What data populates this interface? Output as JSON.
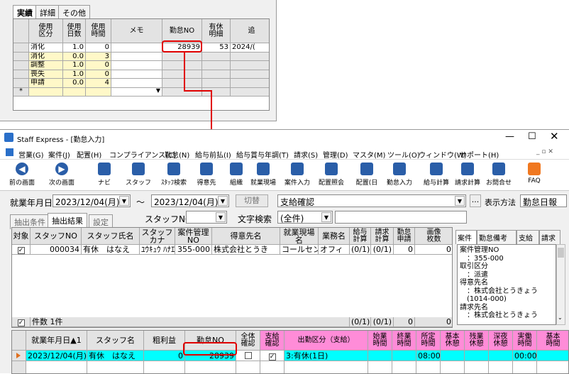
{
  "top": {
    "tabs": [
      "実績",
      "詳細",
      "その他"
    ],
    "headers": [
      "使用\n区分",
      "使用\n日数",
      "使用\n時間",
      "メモ",
      "勤怠NO",
      "有休\n明細",
      "追"
    ],
    "rows": [
      {
        "kubun": "消化",
        "days": "1.0",
        "hours": "0",
        "kintai": "28939",
        "yukyu": "53",
        "extra": "2024/("
      },
      {
        "kubun": "消化",
        "days": "0.0",
        "hours": "3",
        "kintai": "",
        "yukyu": "",
        "extra": ""
      },
      {
        "kubun": "調整",
        "days": "1.0",
        "hours": "0",
        "kintai": "",
        "yukyu": "",
        "extra": ""
      },
      {
        "kubun": "喪失",
        "days": "1.0",
        "hours": "0",
        "kintai": "",
        "yukyu": "",
        "extra": ""
      },
      {
        "kubun": "申請",
        "days": "0.0",
        "hours": "4",
        "kintai": "",
        "yukyu": "",
        "extra": ""
      }
    ],
    "new_row_marker": "*"
  },
  "window": {
    "title": "Staff Express - [勤怠入力]",
    "menu": [
      "営業(G)",
      "案件(J)",
      "配置(H)",
      "コンプライアンス(C)",
      "勤怠(N)",
      "給与前払(I)",
      "給与賞与年調(T)",
      "請求(S)",
      "管理(D)",
      "マスタ(M)",
      "ツール(O)",
      "ウィンドウ(W)",
      "サポート(H)"
    ],
    "toolbar": [
      "前の画面",
      "次の画面",
      "ナビ",
      "スタッフ",
      "ｽﾀｯﾌ検索",
      "得意先",
      "組織",
      "就業現場",
      "案件入力",
      "配置照会",
      "配置(日",
      "勤怠入力",
      "給与計算",
      "請求計算",
      "お問合せ",
      "FAQ"
    ],
    "colors": {
      "toolbar_icon": "#2a5ea8",
      "faq": "#f07820",
      "yellow": "#fff8c8",
      "cyan": "#00ffff",
      "pink": "#ff8cd8",
      "red": "#e00000"
    }
  },
  "filter": {
    "date_label": "就業年月日",
    "date_from": "2023/12/04(月)",
    "tilde": "～",
    "date_to": "2023/12/04(月)",
    "switch_label": "切替",
    "mode": "支給確認",
    "ellipsis": "...",
    "display_label": "表示方法",
    "display_value": "勤怠日報",
    "tabs": [
      "抽出条件",
      "抽出結果",
      "設定"
    ],
    "staff_no_label": "スタッフNO",
    "text_search_label": "文字検索",
    "text_search_value": "(全件)"
  },
  "result": {
    "headers": [
      "対象",
      "スタッフNO",
      "スタッフ氏名",
      "スタッフ\nカナ",
      "案件管理\nNO",
      "得意先名",
      "就業現場\n名",
      "業務名",
      "給与\n計算",
      "請求\n計算",
      "勤怠\n申請",
      "画像\n枚数"
    ],
    "row": {
      "checked": "✓",
      "staff_no": "000034",
      "name": "有休　はなえ",
      "kana": "ﾕｳｷｭｳ ﾊﾅｴ",
      "case_no": "355-000",
      "client": "株式会社とうき",
      "site": "コールセン",
      "work": "オフィ",
      "pay": "(0/1)",
      "bill": "(0/1)",
      "apply": "0",
      "images": "0"
    },
    "footer": {
      "checked": "✓",
      "count": "件数 1件",
      "pay": "(0/1)",
      "bill": "(0/1)",
      "apply": "0",
      "images": "0"
    }
  },
  "side": {
    "tabs": [
      "案件",
      "勤怠備考",
      "支給",
      "請求"
    ],
    "lines": [
      "案件管理NO",
      "　：355-000",
      "取引区分",
      "　：派遣",
      "得意先名",
      "　：株式会社とうきょう",
      "　(1014-000)",
      "請求先名",
      "　：株式会社とうきょう"
    ]
  },
  "bottom": {
    "headers": [
      "就業年月日▲1",
      "スタッフ名",
      "粗利益",
      "勤怠NO",
      "全体\n確認",
      "支給\n確認",
      "出勤区分（支給）",
      "始業\n時間",
      "終業\n時間",
      "所定\n時間",
      "基本\n休憩",
      "残業\n休憩",
      "深夜\n休憩",
      "実働\n時間",
      "基本\n時間"
    ],
    "row": {
      "date": "2023/12/04(月)",
      "name": "有休　はなえ",
      "profit": "0",
      "kintai": "28939",
      "kubun": "3:有休(1日)",
      "shotei": "08:00",
      "jitsudo": "00:00",
      "check": "✓"
    }
  }
}
